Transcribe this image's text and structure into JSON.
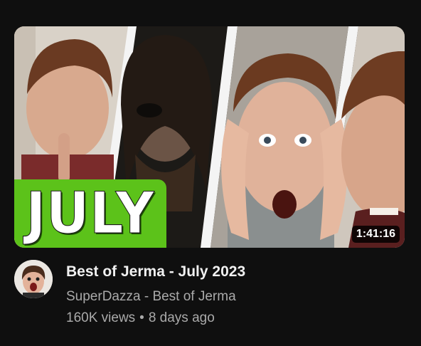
{
  "video": {
    "title": "Best of Jerma - July 2023",
    "duration": "1:41:16",
    "thumbnail_badge": "JULY",
    "badge_color": "#5cc21a"
  },
  "channel": {
    "name": "SuperDazza - Best of Jerma"
  },
  "stats": {
    "views": "160K views",
    "separator": "•",
    "age": "8 days ago"
  },
  "colors": {
    "background": "#0f0f0f",
    "title_text": "#f1f1f1",
    "secondary_text": "#aaaaaa"
  },
  "icons": {
    "avatar": "channel-avatar-icon"
  }
}
